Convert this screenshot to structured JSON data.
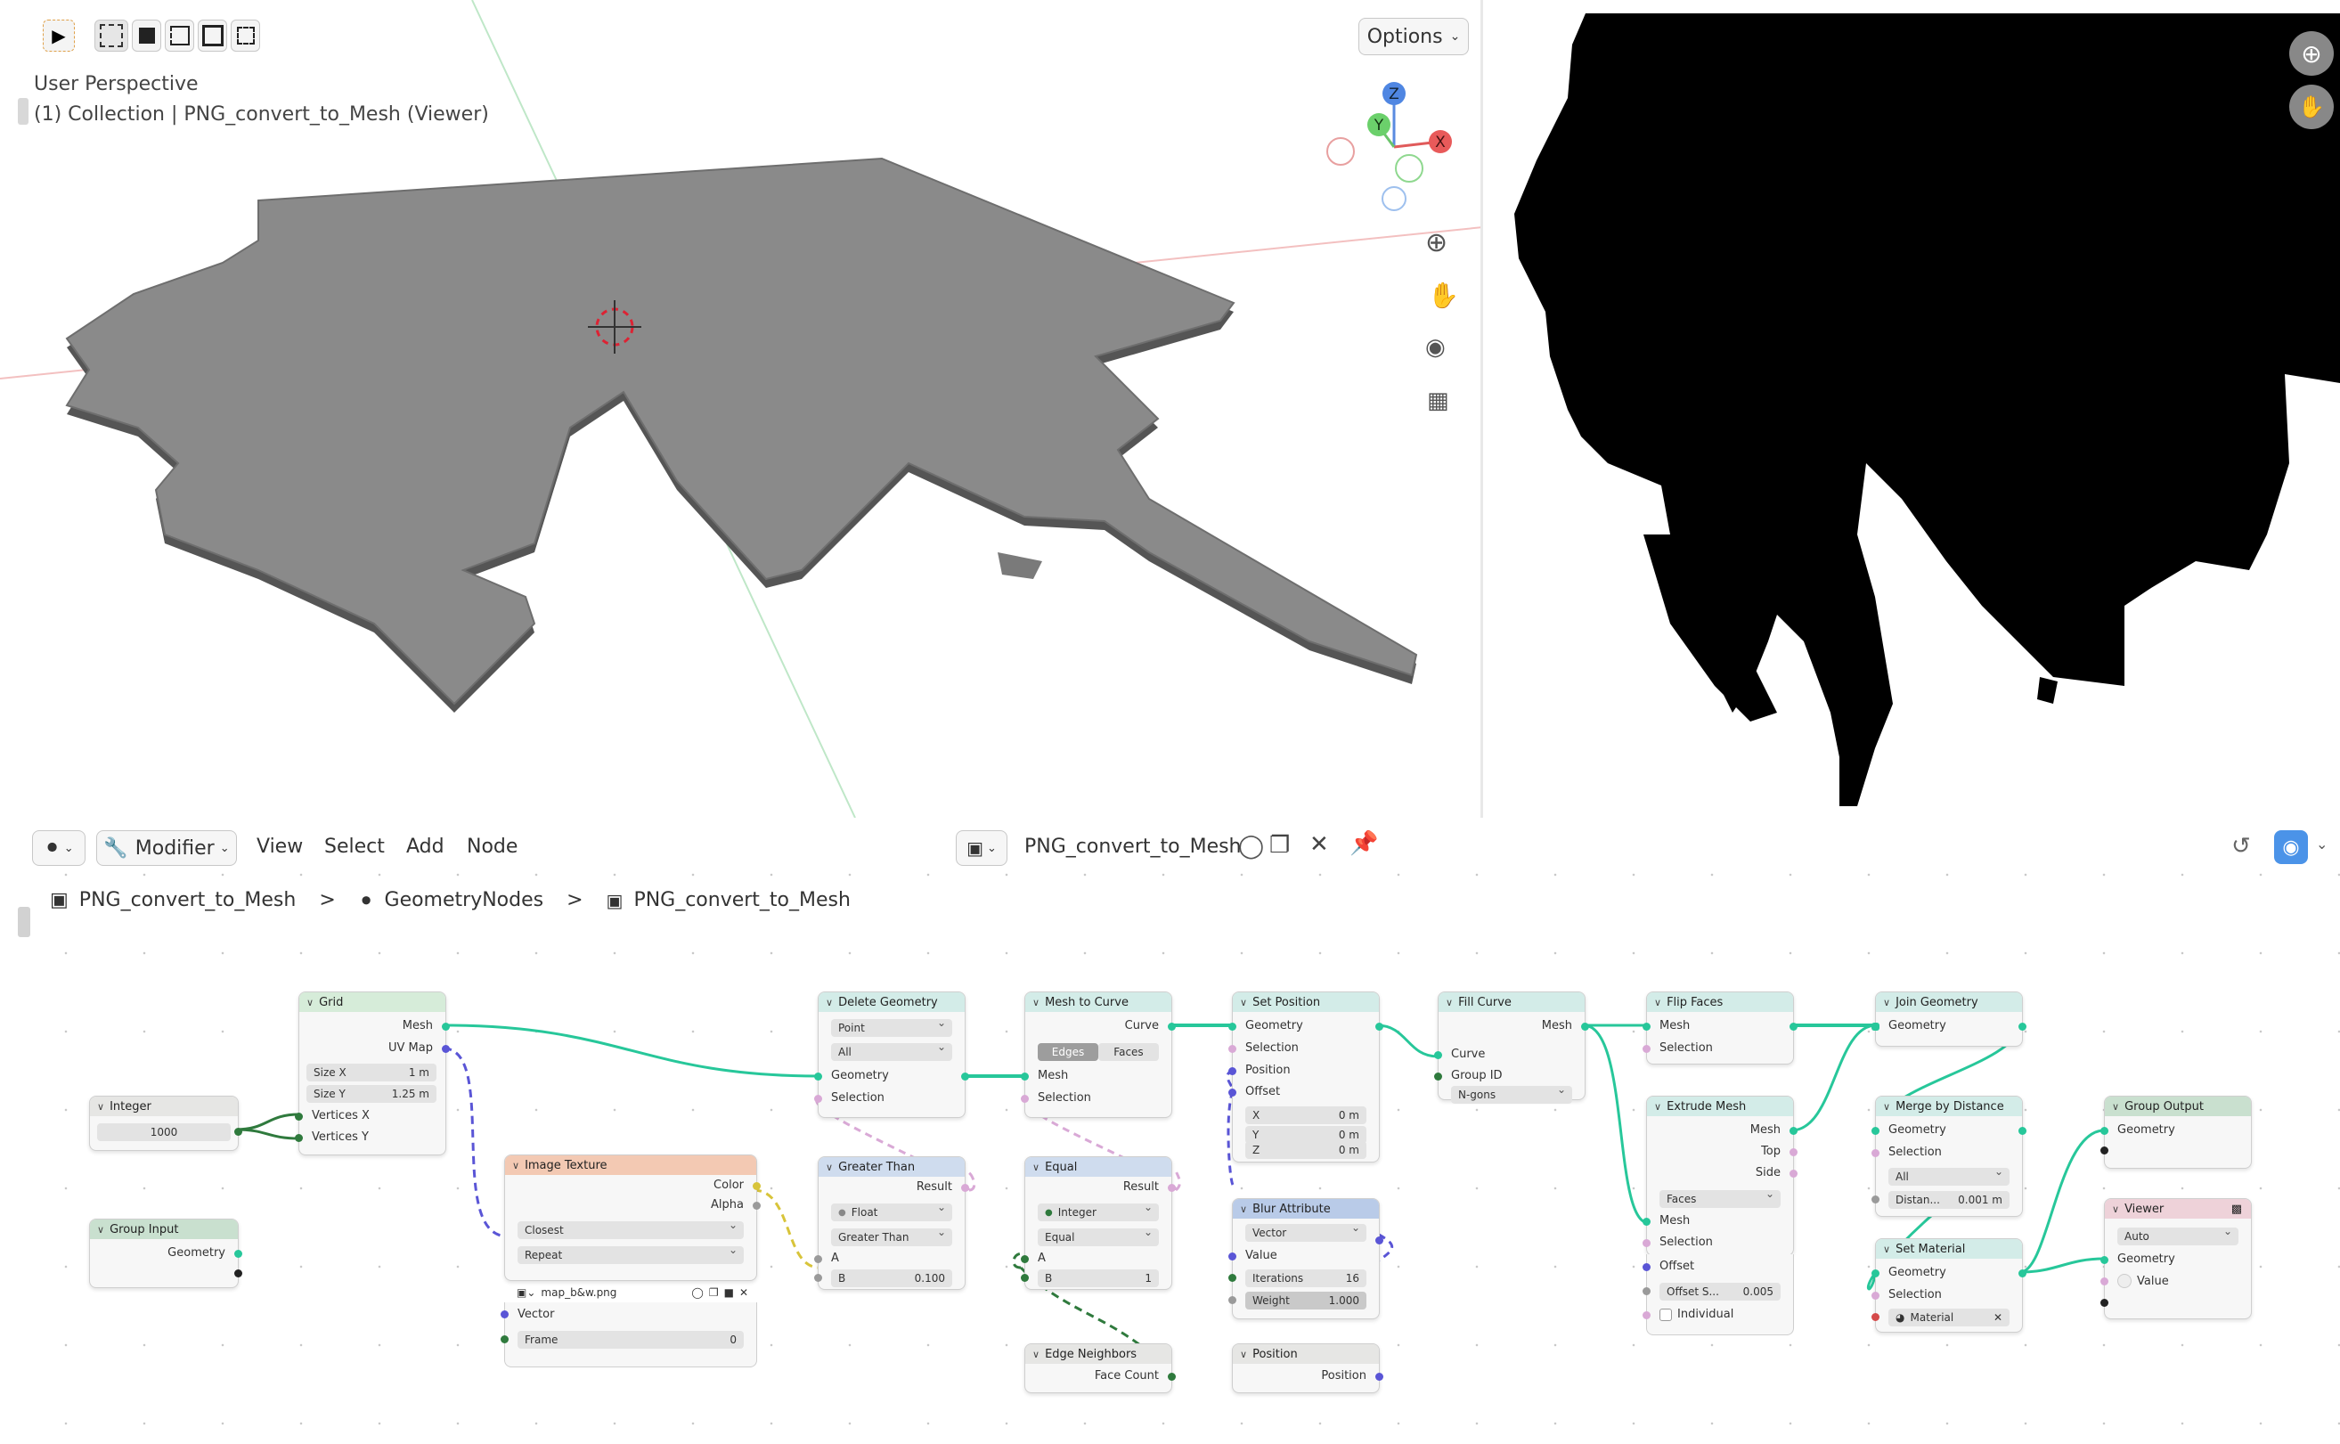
{
  "viewport": {
    "view_name": "User Perspective",
    "collection_label": "(1) Collection | PNG_convert_to_Mesh (Viewer)",
    "options_label": "Options",
    "gizmo": {
      "z": "Z",
      "y": "Y",
      "x": "X"
    }
  },
  "editor_header": {
    "mode_label": "Modifier",
    "menus": [
      "View",
      "Select",
      "Add",
      "Node"
    ],
    "tree_name": "PNG_convert_to_Mesh"
  },
  "breadcrumb": {
    "items": [
      "PNG_convert_to_Mesh",
      "GeometryNodes",
      "PNG_convert_to_Mesh"
    ],
    "separator": ">"
  },
  "nodes": {
    "integer": {
      "title": "Integer",
      "value": "1000"
    },
    "group_input": {
      "title": "Group Input",
      "geometry": "Geometry"
    },
    "grid": {
      "title": "Grid",
      "mesh": "Mesh",
      "uv_map": "UV Map",
      "size_x_label": "Size X",
      "size_x": "1 m",
      "size_y_label": "Size Y",
      "size_y": "1.25 m",
      "vertices_x": "Vertices X",
      "vertices_y": "Vertices Y"
    },
    "image_texture": {
      "title": "Image Texture",
      "color": "Color",
      "alpha": "Alpha",
      "interp": "Closest",
      "ext": "Repeat",
      "image": "map_b&w.png",
      "vector": "Vector",
      "frame": "Frame",
      "frame_value": "0"
    },
    "delete_geometry": {
      "title": "Delete Geometry",
      "domain": "Point",
      "mode": "All",
      "geometry": "Geometry",
      "selection": "Selection"
    },
    "greater_than": {
      "title": "Greater Than",
      "result": "Result",
      "type": "Float",
      "op": "Greater Than",
      "a": "A",
      "b": "B",
      "b_value": "0.100"
    },
    "mesh_to_curve": {
      "title": "Mesh to Curve",
      "curve": "Curve",
      "edges": "Edges",
      "faces": "Faces",
      "mesh": "Mesh",
      "selection": "Selection"
    },
    "equal": {
      "title": "Equal",
      "result": "Result",
      "type": "Integer",
      "op": "Equal",
      "a": "A",
      "b": "B",
      "b_value": "1"
    },
    "edge_neighbors": {
      "title": "Edge Neighbors",
      "face_count": "Face Count"
    },
    "set_position": {
      "title": "Set Position",
      "geometry": "Geometry",
      "selection": "Selection",
      "position": "Position",
      "offset": "Offset",
      "x": "X",
      "y": "Y",
      "z": "Z",
      "x_val": "0 m",
      "y_val": "0 m",
      "z_val": "0 m"
    },
    "blur_attribute": {
      "title": "Blur Attribute",
      "type": "Vector",
      "value": "Value",
      "iterations": "Iterations",
      "iterations_val": "16",
      "weight": "Weight",
      "weight_val": "1.000"
    },
    "position": {
      "title": "Position",
      "position": "Position"
    },
    "fill_curve": {
      "title": "Fill Curve",
      "mesh": "Mesh",
      "curve": "Curve",
      "group_id": "Group ID",
      "mode": "N-gons"
    },
    "flip_faces": {
      "title": "Flip Faces",
      "mesh": "Mesh",
      "selection": "Selection"
    },
    "extrude_mesh": {
      "title": "Extrude Mesh",
      "mesh": "Mesh",
      "top": "Top",
      "side": "Side",
      "mode": "Faces",
      "mesh_in": "Mesh",
      "selection": "Selection",
      "offset": "Offset",
      "offset_scale": "Offset S...",
      "offset_scale_val": "0.005",
      "individual": "Individual"
    },
    "join_geometry": {
      "title": "Join Geometry",
      "geometry": "Geometry"
    },
    "merge_by_distance": {
      "title": "Merge by Distance",
      "geometry": "Geometry",
      "selection": "Selection",
      "mode": "All",
      "distance": "Distan...",
      "distance_val": "0.001 m"
    },
    "set_material": {
      "title": "Set Material",
      "geometry": "Geometry",
      "selection": "Selection",
      "material": "Material"
    },
    "group_output": {
      "title": "Group Output",
      "geometry": "Geometry"
    },
    "viewer": {
      "title": "Viewer",
      "domain": "Auto",
      "geometry": "Geometry",
      "value": "Value"
    }
  }
}
